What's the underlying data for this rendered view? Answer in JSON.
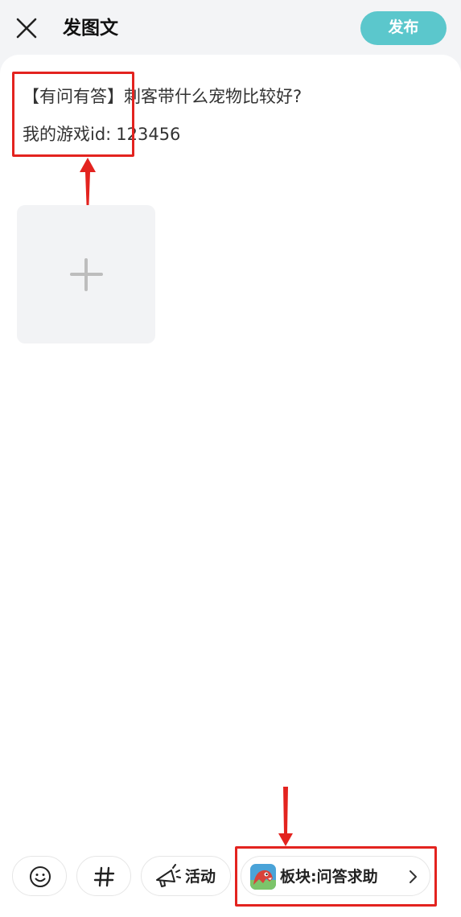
{
  "header": {
    "title": "发图文",
    "publish_label": "发布",
    "close_icon": "close-icon"
  },
  "editor": {
    "title_prefix": "【有问有答】",
    "title_text": "刺客带什么宠物比较好?",
    "id_prefix": "我的游戏id:",
    "id_value": "123456"
  },
  "image_upload": {
    "icon": "plus-icon"
  },
  "toolbar": {
    "emoji_icon": "emoji-icon",
    "topic_icon": "hashtag-icon",
    "activity_icon": "megaphone-icon",
    "activity_label": "活动",
    "section_label": "板块:问答求助",
    "section_icon": "game-icon",
    "chevron_icon": "chevron-right-icon"
  },
  "colors": {
    "accent": "#5bc7cc",
    "annotation": "#e3231f",
    "background": "#f3f4f6"
  }
}
